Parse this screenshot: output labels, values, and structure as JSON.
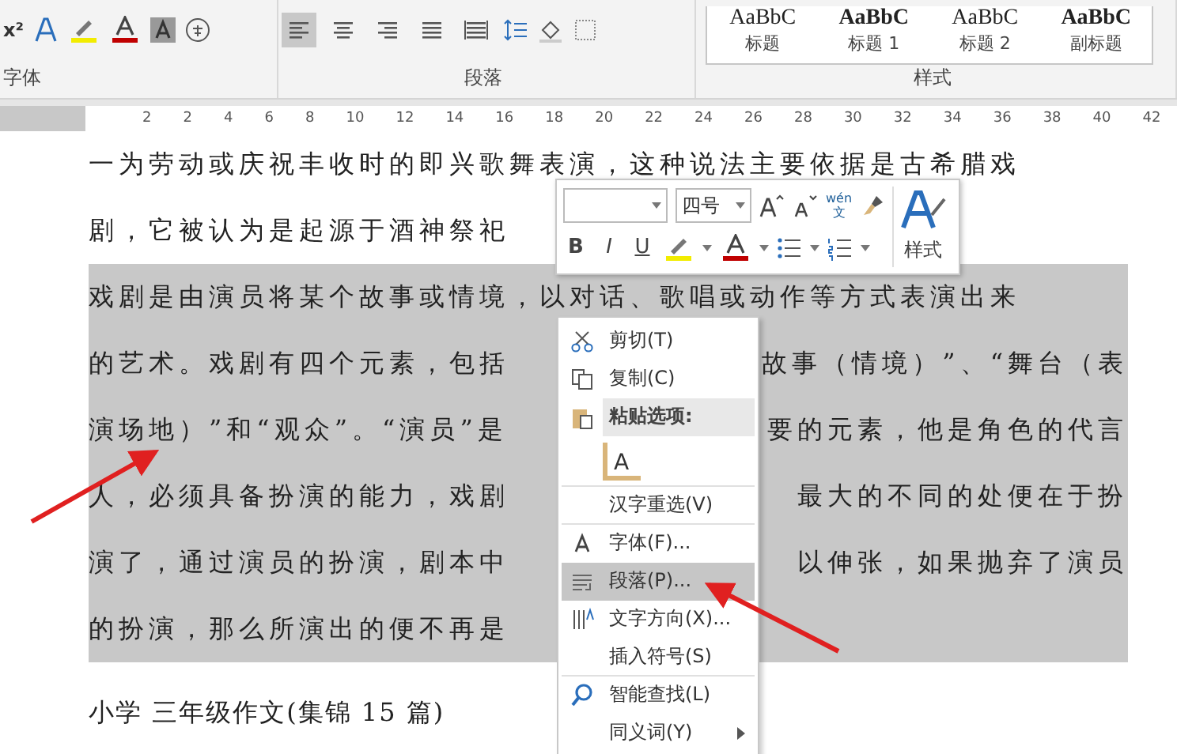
{
  "ribbon": {
    "groups": [
      {
        "label": "字体"
      },
      {
        "label": "段落"
      },
      {
        "label": "样式"
      }
    ],
    "superscript": "x²",
    "styles": [
      {
        "preview": "AaBbC",
        "name": "标题",
        "kind": "title"
      },
      {
        "preview": "AaBbC",
        "name": "标题 1",
        "kind": "heading"
      },
      {
        "preview": "AaBbC",
        "name": "标题 2",
        "kind": "title"
      },
      {
        "preview": "AaBbC",
        "name": "副标题",
        "kind": "heading"
      }
    ],
    "alignment": [
      {
        "kind": "left",
        "selected": true
      },
      {
        "kind": "center",
        "selected": false
      },
      {
        "kind": "right",
        "selected": false
      },
      {
        "kind": "justify",
        "selected": false
      },
      {
        "kind": "distribute",
        "selected": false
      }
    ]
  },
  "ruler": {
    "labels": [
      "2",
      "2",
      "4",
      "6",
      "8",
      "10",
      "12",
      "14",
      "16",
      "18",
      "20",
      "22",
      "24",
      "26",
      "28",
      "30",
      "32",
      "34",
      "36",
      "38",
      "40",
      "42"
    ]
  },
  "document": {
    "lines": [
      {
        "left": "一为劳动或庆祝丰收时的即兴歌舞表演，这种说法主要依据是古希腊戏",
        "selected": false
      },
      {
        "left": "剧，它被认为是起源于酒神祭祀",
        "selected": false
      },
      {
        "left": "戏剧是由演员将某个故事或情境，以对话、歌唱或动作等方式表演出来",
        "selected": true
      },
      {
        "left": "的艺术。戏剧有四个元素，包括",
        "right": "故事（情境）”、“舞台（表",
        "selected": true
      },
      {
        "left": "演场地）”和“观众”。“演员”是",
        "right": "要的元素，他是角色的代言",
        "selected": true
      },
      {
        "left": "人，必须具备扮演的能力，戏剧",
        "right": "最大的不同的处便在于扮",
        "selected": true
      },
      {
        "left": "演了，通过演员的扮演，剧本中",
        "right": "以伸张，如果抛弃了演员",
        "selected": true
      },
      {
        "left": "的扮演，那么所演出的便不再是",
        "selected": true
      }
    ],
    "heading": "小学 三年级作文(集锦 15 篇)"
  },
  "mini_toolbar": {
    "font_size": "四号",
    "phonetic": "wén",
    "phonetic_char": "文",
    "bold": "B",
    "italic": "I",
    "underline": "U",
    "styles": "样式"
  },
  "context_menu": [
    {
      "kind": "cut",
      "label": "剪切(T)",
      "selected": false,
      "divider": false
    },
    {
      "kind": "copy",
      "label": "复制(C)",
      "selected": false,
      "divider": false
    },
    {
      "kind": "header",
      "label": "粘贴选项:",
      "selected": false,
      "divider": false
    },
    {
      "kind": "paste",
      "label": "A",
      "selected": false,
      "divider": true
    },
    {
      "kind": "plain",
      "label": "汉字重选(V)",
      "selected": false,
      "divider": true
    },
    {
      "kind": "font",
      "label": "字体(F)...",
      "selected": false,
      "divider": false
    },
    {
      "kind": "paragraph",
      "label": "段落(P)...",
      "selected": true,
      "divider": false
    },
    {
      "kind": "direction",
      "label": "文字方向(X)...",
      "selected": false,
      "divider": false
    },
    {
      "kind": "plain",
      "label": "插入符号(S)",
      "selected": false,
      "divider": true
    },
    {
      "kind": "lookup",
      "label": "智能查找(L)",
      "selected": false,
      "divider": false
    },
    {
      "kind": "submenu",
      "label": "同义词(Y)",
      "selected": false,
      "divider": false
    }
  ]
}
